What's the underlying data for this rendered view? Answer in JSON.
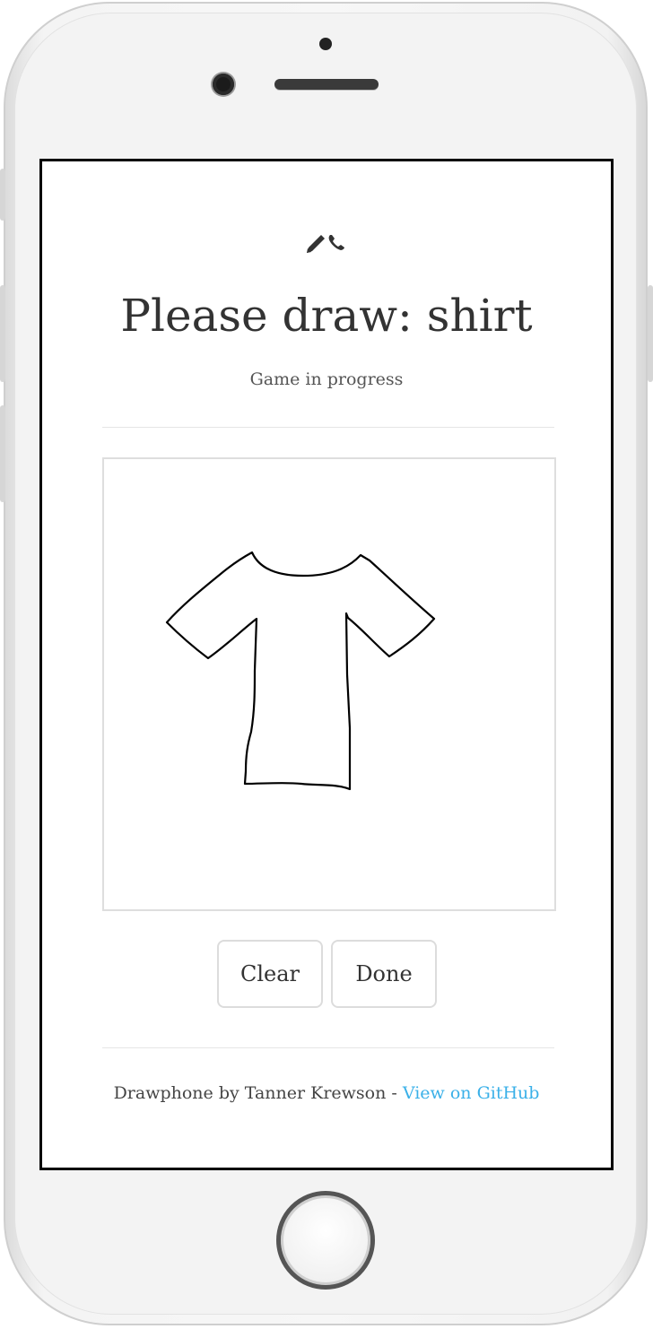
{
  "header": {
    "logo_text": "✏📞",
    "title": "Please draw: shirt",
    "status": "Game in progress"
  },
  "canvas": {
    "drawing_subject": "shirt"
  },
  "actions": {
    "clear_label": "Clear",
    "done_label": "Done"
  },
  "footer": {
    "credit_text": "Drawphone by Tanner Krewson - ",
    "github_link_label": "View on GitHub"
  },
  "colors": {
    "link": "#3ab0e8",
    "text": "#333333",
    "frame_border": "#000000"
  }
}
